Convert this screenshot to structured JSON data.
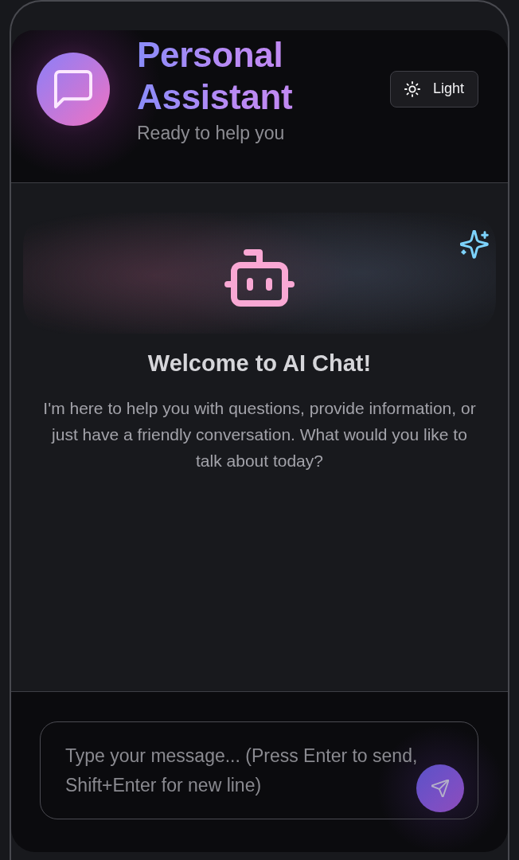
{
  "header": {
    "title": "Personal Assistant",
    "subtitle": "Ready to help you",
    "theme_button": {
      "label": "Light"
    }
  },
  "welcome": {
    "title": "Welcome to AI Chat!",
    "message": "I'm here to help you with questions, provide information, or just have a friendly conversation. What would you like to talk about today?"
  },
  "composer": {
    "placeholder": "Type your message... (Press Enter to send, Shift+Enter for new line)"
  }
}
